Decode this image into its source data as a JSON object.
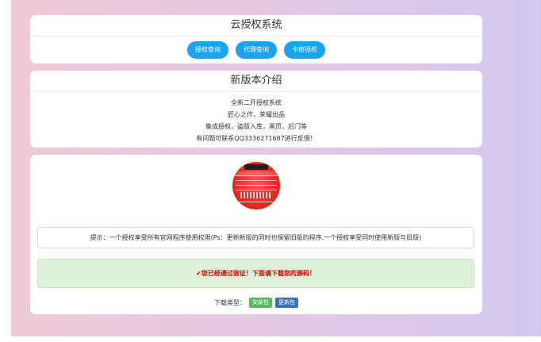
{
  "header": {
    "title": "云授权系统",
    "buttons": [
      "授权查询",
      "代理查询",
      "卡密授权"
    ]
  },
  "intro": {
    "title": "新版本介绍",
    "lines": [
      "全新二开授权系统",
      "匠心之作，荣耀出品",
      "集成授权，盗版入库，黑页，后门等",
      "有问题可联系QQ3336271687进行反馈！"
    ]
  },
  "download": {
    "notice": "提示：一个授权享受所有官网程序使用权限(Ps：更新新版的同时也保留旧版的程序,一个授权享受同时使用新版与旧版)",
    "success": "✔您已经通过验证！下面请下载您的源码！",
    "type_label": "下载类型：",
    "install_label": "安装包",
    "update_label": "更新包"
  },
  "colors": {
    "accent": "#1aa3f0",
    "success_bg": "#dff0d8",
    "success_text": "#cc0000",
    "install_tag": "#5cb85c",
    "update_tag": "#3a72b8"
  }
}
